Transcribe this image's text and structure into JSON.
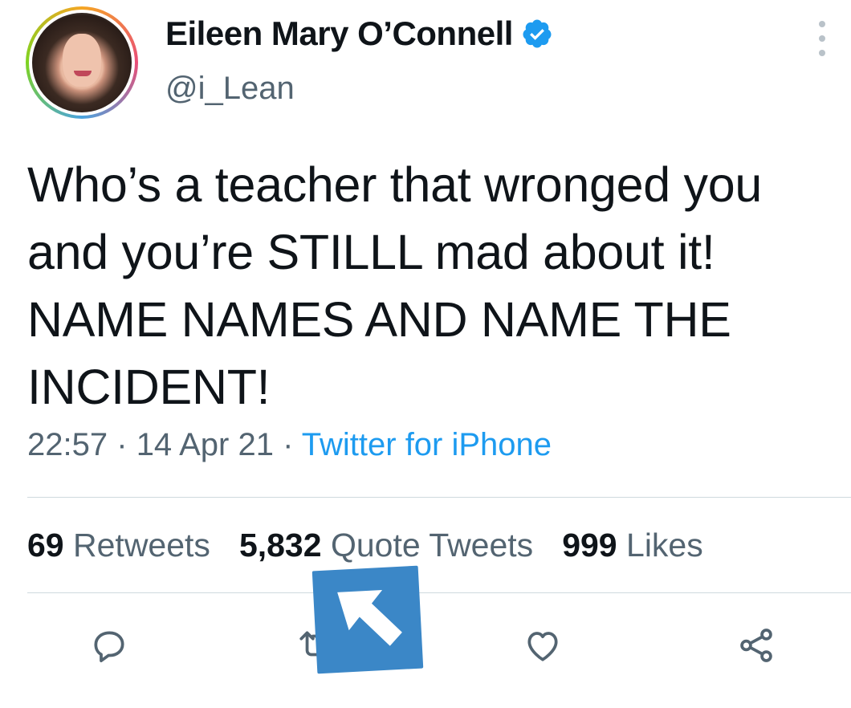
{
  "author": {
    "display_name": "Eileen Mary O’Connell",
    "handle": "@i_Lean",
    "verified_icon": "verified-badge-icon",
    "avatar_icon": "profile-photo"
  },
  "tweet": {
    "text": "Who’s a teacher that wronged you\nand you’re STILLL mad about it!\nNAME NAMES AND NAME THE\nINCIDENT!",
    "time": "22:57",
    "date": "14 Apr 21",
    "separator": "·",
    "source": "Twitter for iPhone"
  },
  "stats": {
    "retweets_count": "69",
    "retweets_label": "Retweets",
    "quotes_count": "5,832",
    "quotes_label": "Quote Tweets",
    "likes_count": "999",
    "likes_label": "Likes"
  },
  "actions": [
    "reply-icon",
    "retweet-icon",
    "like-icon",
    "share-icon"
  ],
  "colors": {
    "text": "#0f1419",
    "secondary": "#536471",
    "link": "#1d9bf0",
    "divider": "#cfd9de",
    "overlay": "#3b87c7"
  }
}
